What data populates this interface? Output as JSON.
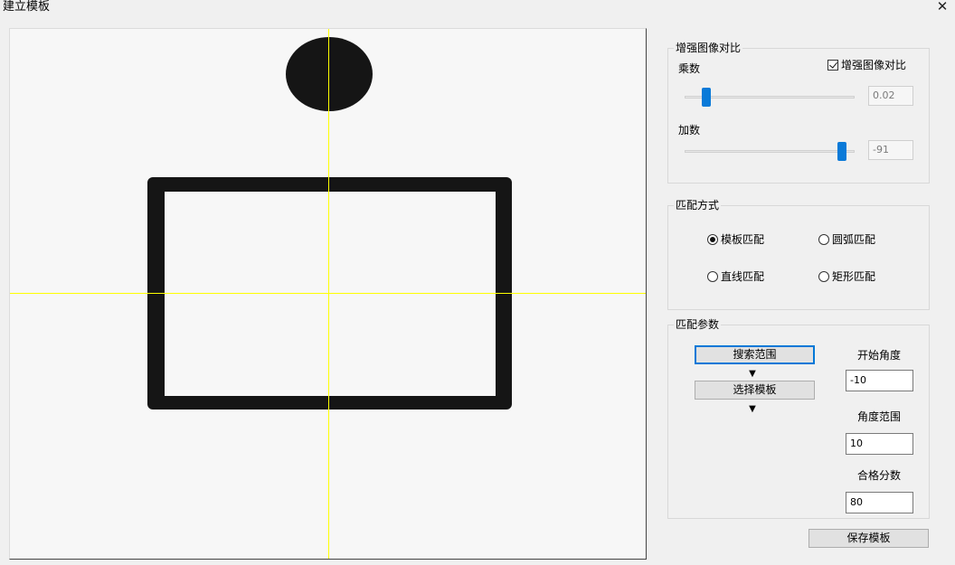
{
  "window": {
    "title": "建立模板",
    "close_glyph": "✕"
  },
  "contrast_group": {
    "title": "增强图像对比",
    "checkbox_label": "增强图像对比",
    "checked": true,
    "multiplier_label": "乘数",
    "multiplier_value": "0.02",
    "multiplier_slider_fraction": 0.13,
    "offset_label": "加数",
    "offset_value": "-91",
    "offset_slider_fraction": 0.927
  },
  "match_mode_group": {
    "title": "匹配方式",
    "options": [
      {
        "label": "模板匹配",
        "selected": true
      },
      {
        "label": "圆弧匹配",
        "selected": false
      },
      {
        "label": "直线匹配",
        "selected": false
      },
      {
        "label": "矩形匹配",
        "selected": false
      }
    ]
  },
  "match_params_group": {
    "title": "匹配参数",
    "search_range_button": "搜索范围",
    "select_template_button": "选择模板",
    "arrow_glyph": "▼",
    "start_angle_label": "开始角度",
    "start_angle_value": "-10",
    "angle_range_label": "角度范围",
    "angle_range_value": "10",
    "pass_score_label": "合格分数",
    "pass_score_value": "80"
  },
  "save_button": "保存模板",
  "colors": {
    "crosshair": "#ffff00",
    "slider_thumb": "#0a7ad8",
    "focus_border": "#0078d7",
    "shape_fill": "#151515"
  }
}
